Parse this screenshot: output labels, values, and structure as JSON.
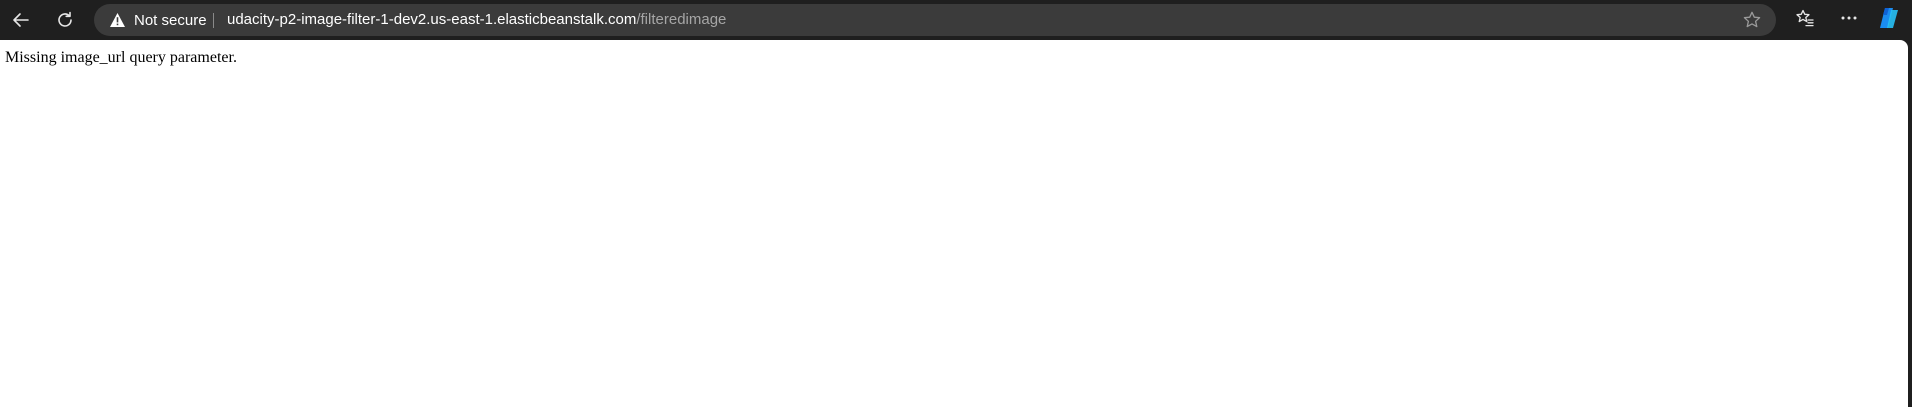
{
  "browser": {
    "icons": {
      "back": "arrow-left-icon",
      "reload": "refresh-icon",
      "security": "warning-triangle-icon",
      "favorite": "star-outline-icon",
      "favorites": "favorites-list-icon",
      "more": "more-horizontal-icon",
      "copilot": "copilot-icon"
    },
    "address_bar": {
      "security_label": "Not secure",
      "url_host": "udacity-p2-image-filter-1-dev2.us-east-1.elasticbeanstalk.com",
      "url_path": "/filteredimage"
    },
    "colors": {
      "chrome_background": "#1f1f1f",
      "omnibox_background": "#3b3b3b",
      "page_background": "#ffffff",
      "copilot_blue": "#1a8cf0"
    }
  },
  "page": {
    "message": "Missing image_url query parameter."
  }
}
